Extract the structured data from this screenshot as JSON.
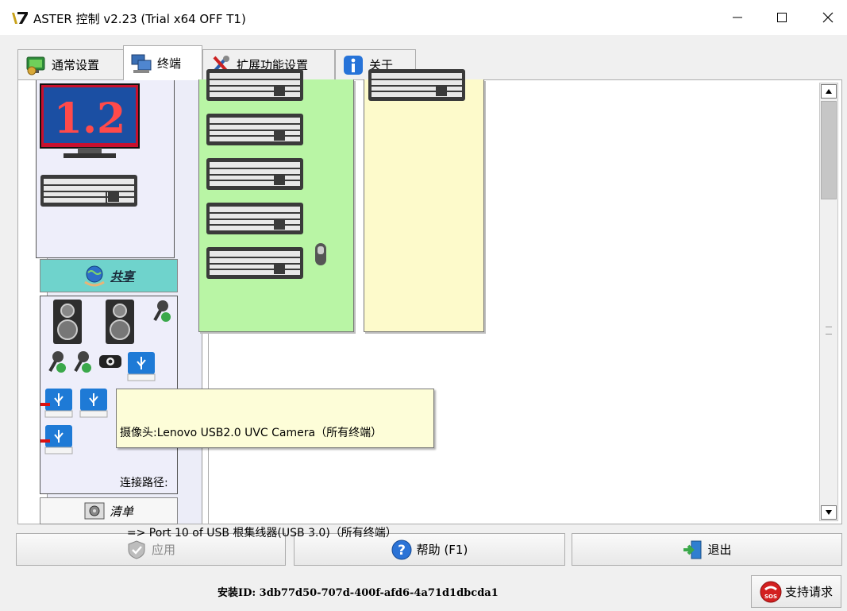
{
  "window": {
    "title": "ASTER 控制 v2.23 (Trial x64 OFF T1)"
  },
  "tabs": [
    {
      "label": "通常设置",
      "icon": "settings-screen-icon",
      "active": false
    },
    {
      "label": "终端",
      "icon": "terminals-icon",
      "active": true
    },
    {
      "label": "扩展功能设置",
      "icon": "tools-icon",
      "active": false
    },
    {
      "label": "关于",
      "icon": "info-icon",
      "active": false
    }
  ],
  "terminal_panel": {
    "screen_label": "1.2",
    "share_label": "共享",
    "list_label": "清单",
    "colors": {
      "green_column": "#b9f5a5",
      "yellow_column": "#fdfacb",
      "share_button": "#6fd3cc"
    }
  },
  "tooltip": {
    "line1": "摄像头:Lenovo USB2.0 UVC Camera（所有终端）",
    "line2": "连接路径:",
    "line3": "  => Port 10 of USB 根集线器(USB 3.0)（所有终端）"
  },
  "buttons": {
    "apply": "应用",
    "help": "帮助 (F1)",
    "exit": "退出",
    "support": "支持请求"
  },
  "install_id": "安装ID: 3db77d50-707d-400f-afd6-4a71d1dbcda1"
}
